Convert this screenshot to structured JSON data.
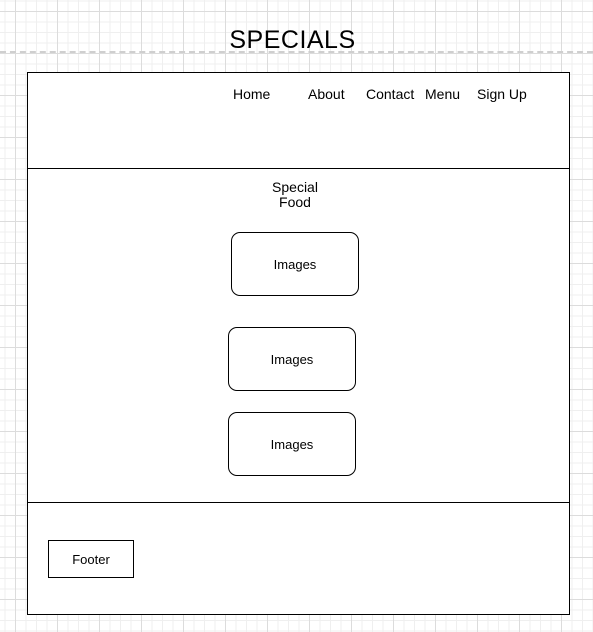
{
  "title": "SPECIALS",
  "nav": [
    "Home",
    "About",
    "Contact",
    "Menu",
    "Sign Up"
  ],
  "section_heading": [
    "Special",
    "Food"
  ],
  "images": [
    "Images",
    "Images",
    "Images"
  ],
  "footer": "Footer"
}
